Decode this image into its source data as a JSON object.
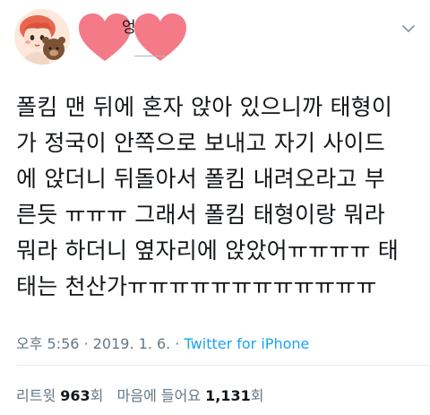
{
  "profile": {
    "name_fragment": "엉",
    "caret_icon": "chevron-down-icon",
    "avatar_icon": "cartoon-avatar-with-bear",
    "hearts_icon": "two-pink-hearts"
  },
  "tweet": {
    "text": "폴킴 맨 뒤에 혼자 앉아 있으니까 태형이\n가 정국이 안쪽으로 보내고 자기 사이드\n에 앉더니 뒤돌아서 폴킴 내려오라고 부\n른듯 ㅠㅠㅠ 그래서 폴킴 태형이랑 뭐라\n뭐라 하더니 옆자리에 앉았어ㅠㅠㅠㅠ 태\n태는 천산가ㅠㅠㅠㅠㅠㅠㅠㅠㅠㅠㅠㅠ",
    "time": "오후 5:56",
    "separator": "·",
    "date": "2019. 1. 6.",
    "source": "Twitter for iPhone"
  },
  "stats": {
    "retweets_label": "리트윗",
    "retweets_count": "963",
    "retweets_unit": "회",
    "likes_label": "마음에 들어요",
    "likes_count": "1,131",
    "likes_unit": "회"
  },
  "colors": {
    "text": "#14171a",
    "muted": "#657786",
    "link": "#1da1f2",
    "heart": "#f47a87"
  }
}
